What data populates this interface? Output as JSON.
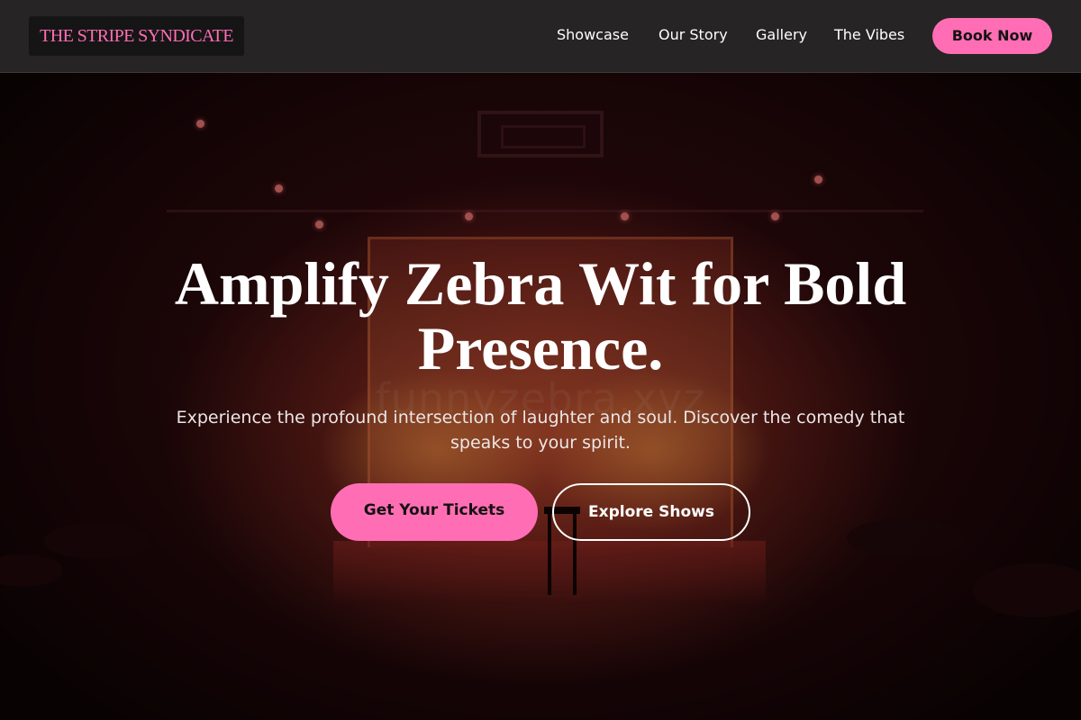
{
  "brand": {
    "name": "THE STRIPE SYNDICATE"
  },
  "nav": {
    "links": [
      {
        "label": "Showcase"
      },
      {
        "label": "Our Story"
      },
      {
        "label": "Gallery"
      },
      {
        "label": "The Vibes"
      }
    ],
    "book_label": "Book Now"
  },
  "hero": {
    "headline": "Amplify Zebra Wit for Bold Presence.",
    "subtext": "Experience the profound intersection of laughter and soul. Discover the comedy that speaks to your spirit.",
    "watermark": "funnyzebra.xyz",
    "primary_cta": "Get Your Tickets",
    "secondary_cta": "Explore Shows"
  },
  "colors": {
    "accent": "#ff6eb4",
    "navbar": "#262425",
    "logo_bg": "#161516"
  }
}
